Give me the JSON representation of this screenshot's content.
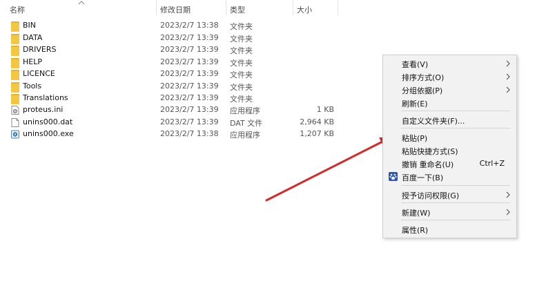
{
  "header": {
    "col_name": "名称",
    "col_date": "修改日期",
    "col_type": "类型",
    "col_size": "大小"
  },
  "files": [
    {
      "name": "BIN",
      "date": "2023/2/7 13:38",
      "type": "文件夹",
      "size": "",
      "icon": "folder-icon"
    },
    {
      "name": "DATA",
      "date": "2023/2/7 13:39",
      "type": "文件夹",
      "size": "",
      "icon": "folder-icon"
    },
    {
      "name": "DRIVERS",
      "date": "2023/2/7 13:39",
      "type": "文件夹",
      "size": "",
      "icon": "folder-icon"
    },
    {
      "name": "HELP",
      "date": "2023/2/7 13:39",
      "type": "文件夹",
      "size": "",
      "icon": "folder-icon"
    },
    {
      "name": "LICENCE",
      "date": "2023/2/7 13:39",
      "type": "文件夹",
      "size": "",
      "icon": "folder-icon"
    },
    {
      "name": "Tools",
      "date": "2023/2/7 13:39",
      "type": "文件夹",
      "size": "",
      "icon": "folder-icon"
    },
    {
      "name": "Translations",
      "date": "2023/2/7 13:39",
      "type": "文件夹",
      "size": "",
      "icon": "folder-icon"
    },
    {
      "name": "proteus.ini",
      "date": "2023/2/7 13:39",
      "type": "应用程序",
      "size": "1 KB",
      "icon": "settings-file-icon"
    },
    {
      "name": "unins000.dat",
      "date": "2023/2/7 13:39",
      "type": "DAT 文件",
      "size": "2,964 KB",
      "icon": "file-icon"
    },
    {
      "name": "unins000.exe",
      "date": "2023/2/7 13:38",
      "type": "应用程序",
      "size": "1,207 KB",
      "icon": "installer-icon"
    }
  ],
  "context_menu": {
    "items": [
      {
        "label": "查看(V)",
        "submenu": true
      },
      {
        "label": "排序方式(O)",
        "submenu": true
      },
      {
        "label": "分组依据(P)",
        "submenu": true
      },
      {
        "label": "刷新(E)",
        "submenu": false
      },
      {
        "label": "自定义文件夹(F)...",
        "submenu": false
      },
      {
        "label": "粘贴(P)",
        "submenu": false
      },
      {
        "label": "粘贴快捷方式(S)",
        "submenu": false
      },
      {
        "label": "撤销 重命名(U)",
        "shortcut": "Ctrl+Z",
        "submenu": false
      },
      {
        "label": "百度一下(B)",
        "submenu": false,
        "icon": "baidu-icon"
      },
      {
        "label": "授予访问权限(G)",
        "submenu": true
      },
      {
        "label": "新建(W)",
        "submenu": true
      },
      {
        "label": "属性(R)",
        "submenu": false
      }
    ]
  },
  "colors": {
    "folder": "#f4c741",
    "arrow": "#d42a2a",
    "menu_bg": "#f2f2f2"
  }
}
